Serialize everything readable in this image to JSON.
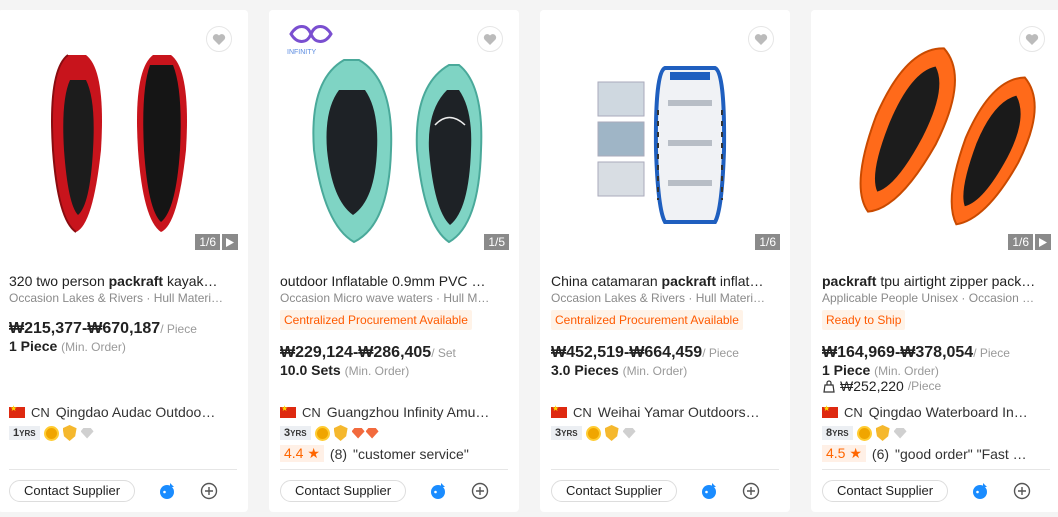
{
  "products": [
    {
      "title_prefix": "320 two person ",
      "title_kw": "packraft",
      "title_suffix": " kayak…",
      "attrs": "Occasion Lakes & Rivers · Hull Materi…",
      "badge": "",
      "price": "₩215,377-₩670,187",
      "price_unit": "/ Piece",
      "moq": "1 Piece",
      "moq_note": "(Min. Order)",
      "unit_price": "",
      "counter": "1/6",
      "has_play": true,
      "country": "CN",
      "supplier": "Qingdao Audac Outdoo…",
      "years": "1",
      "years_suffix": "YRS",
      "rating": "",
      "reviews": "",
      "review_tags": "",
      "contact_label": "Contact Supplier"
    },
    {
      "title_prefix": "outdoor Inflatable 0.9mm PVC ",
      "title_kw": "",
      "title_suffix": "…",
      "attrs": "Occasion Micro wave waters · Hull M…",
      "badge": "Centralized Procurement Available",
      "price": "₩229,124-₩286,405",
      "price_unit": "/ Set",
      "moq": "10.0 Sets",
      "moq_note": "(Min. Order)",
      "unit_price": "",
      "counter": "1/5",
      "has_play": false,
      "logo_text": "INFINITY",
      "country": "CN",
      "supplier": "Guangzhou Infinity Amu…",
      "years": "3",
      "years_suffix": "YRS",
      "rating": "4.4",
      "reviews": "(8)",
      "review_tags": "\"customer service\"",
      "contact_label": "Contact Supplier"
    },
    {
      "title_prefix": "China catamaran ",
      "title_kw": "packraft",
      "title_suffix": " inflat…",
      "attrs": "Occasion Lakes & Rivers · Hull Materi…",
      "badge": "Centralized Procurement Available",
      "price": "₩452,519-₩664,459",
      "price_unit": "/ Piece",
      "moq": "3.0 Pieces",
      "moq_note": "(Min. Order)",
      "unit_price": "",
      "counter": "1/6",
      "has_play": false,
      "country": "CN",
      "supplier": "Weihai Yamar Outdoors…",
      "years": "3",
      "years_suffix": "YRS",
      "rating": "",
      "reviews": "",
      "review_tags": "",
      "contact_label": "Contact Supplier"
    },
    {
      "title_prefix": "",
      "title_kw": "packraft",
      "title_suffix": " tpu airtight zipper pack…",
      "attrs": "Applicable People Unisex · Occasion …",
      "badge": "Ready to Ship",
      "price": "₩164,969-₩378,054",
      "price_unit": "/ Piece",
      "moq": "1 Piece",
      "moq_note": "(Min. Order)",
      "unit_price": "₩252,220",
      "unit_price_suffix": "/Piece",
      "counter": "1/6",
      "has_play": true,
      "country": "CN",
      "supplier": "Qingdao Waterboard In…",
      "years": "8",
      "years_suffix": "YRS",
      "rating": "4.5",
      "reviews": "(6)",
      "review_tags": "\"good order\"  \"Fast …",
      "contact_label": "Contact Supplier"
    }
  ],
  "colors": {
    "accent": "#ff5a00",
    "chat_blue": "#1a8cff"
  }
}
